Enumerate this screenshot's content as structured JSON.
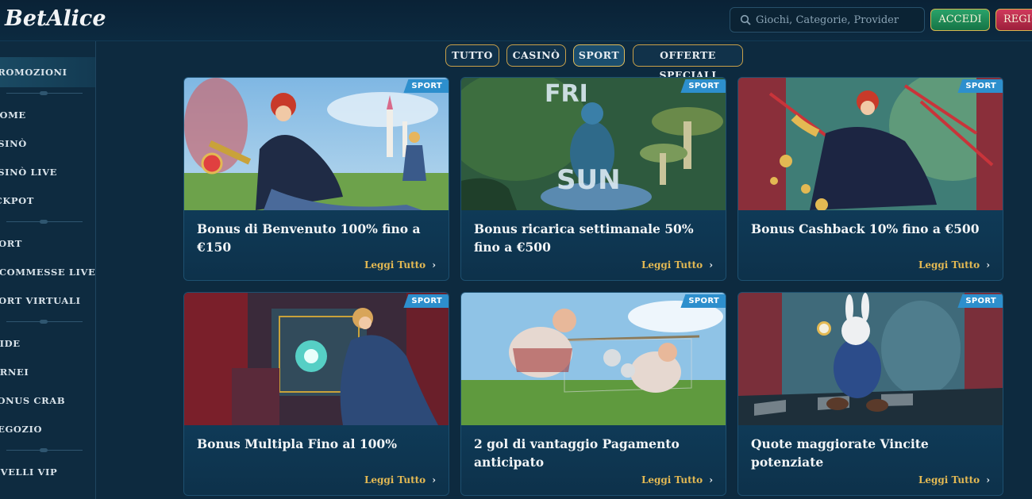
{
  "header": {
    "logo": "BetAlice",
    "search_placeholder": "Giochi, Categorie, Provider",
    "login_label": "ACCEDI",
    "register_label": "REGISTRATI"
  },
  "sidebar": {
    "active_label": "PROMOZIONI",
    "items": [
      {
        "label": "HOME"
      },
      {
        "label": "CASINÒ"
      },
      {
        "label": "CASINÒ LIVE"
      },
      {
        "label": "JACKPOT"
      },
      {
        "label": "SPORT"
      },
      {
        "label": "SCOMMESSE LIVE"
      },
      {
        "label": "SPORT VIRTUALI"
      },
      {
        "label": "SFIDE"
      },
      {
        "label": "TORNEI"
      },
      {
        "label": "BONUS CRAB"
      },
      {
        "label": "NEGOZIO"
      },
      {
        "label": "LIVELLI VIP"
      }
    ]
  },
  "tabs": [
    {
      "label": "TUTTO"
    },
    {
      "label": "CASINÒ"
    },
    {
      "label": "SPORT",
      "active": true
    },
    {
      "label": "OFFERTE SPECIALI"
    }
  ],
  "cards": [
    {
      "badge": "SPORT",
      "title": "Bonus di Benvenuto 100% fino a €150",
      "link": "Leggi Tutto"
    },
    {
      "badge": "SPORT",
      "title": "Bonus ricarica settimanale 50% fino a €500",
      "link": "Leggi Tutto"
    },
    {
      "badge": "SPORT",
      "title": "Bonus Cashback 10% fino a €500",
      "link": "Leggi Tutto"
    },
    {
      "badge": "SPORT",
      "title": "Bonus Multipla Fino al 100%",
      "link": "Leggi Tutto"
    },
    {
      "badge": "SPORT",
      "title": "2 gol di vantaggio Pagamento anticipato",
      "link": "Leggi Tutto"
    },
    {
      "badge": "SPORT",
      "title": "Quote maggiorate Vincite potenziate",
      "link": "Leggi Tutto"
    }
  ],
  "colors": {
    "background": "#0d2a3f",
    "accent_gold": "#e3b953",
    "badge_blue": "#2d8fcd",
    "login_green": "#1f8a57",
    "register_red": "#b42b4b"
  }
}
